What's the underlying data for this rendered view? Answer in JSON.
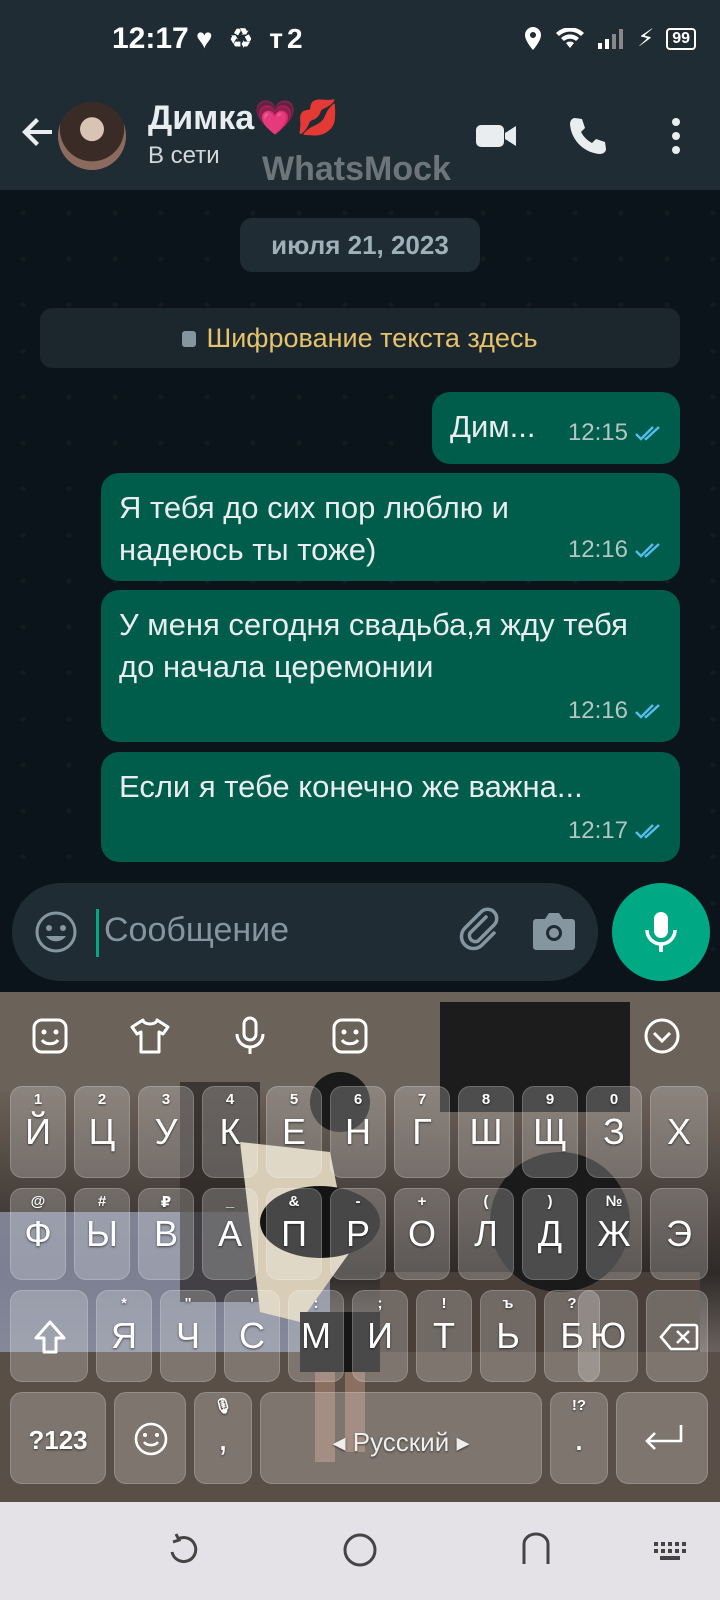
{
  "status_bar": {
    "time": "12:17",
    "left_icons": "♥ ♻ т2",
    "battery": "99"
  },
  "header": {
    "contact_name": "Димка💗💋",
    "status": "В сети",
    "watermark": "WhatsMock"
  },
  "chat": {
    "date_chip": "июля 21, 2023",
    "encryption_notice": "Шифрование текста здесь",
    "messages": [
      {
        "text": "Дим...",
        "time": "12:15"
      },
      {
        "text": "Я тебя до сих пор люблю и надеюсь ты тоже)",
        "time": "12:16"
      },
      {
        "text": "У меня сегодня свадьба,я жду тебя до начала церемонии",
        "time": "12:16"
      },
      {
        "text": "Если я тебе конечно же важна...",
        "time": "12:17"
      }
    ]
  },
  "composer": {
    "placeholder": "Сообщение"
  },
  "keyboard": {
    "row1": [
      {
        "key": "Й",
        "hint": "1"
      },
      {
        "key": "Ц",
        "hint": "2"
      },
      {
        "key": "У",
        "hint": "3"
      },
      {
        "key": "К",
        "hint": "4"
      },
      {
        "key": "Е",
        "hint": "5"
      },
      {
        "key": "Н",
        "hint": "6"
      },
      {
        "key": "Г",
        "hint": "7"
      },
      {
        "key": "Ш",
        "hint": "8"
      },
      {
        "key": "Щ",
        "hint": "9"
      },
      {
        "key": "З",
        "hint": "0"
      },
      {
        "key": "Х",
        "hint": ""
      }
    ],
    "row2": [
      {
        "key": "Ф",
        "hint": "@"
      },
      {
        "key": "Ы",
        "hint": "#"
      },
      {
        "key": "В",
        "hint": "₽"
      },
      {
        "key": "А",
        "hint": "_"
      },
      {
        "key": "П",
        "hint": "&"
      },
      {
        "key": "Р",
        "hint": "-"
      },
      {
        "key": "О",
        "hint": "+"
      },
      {
        "key": "Л",
        "hint": "("
      },
      {
        "key": "Д",
        "hint": ")"
      },
      {
        "key": "Ж",
        "hint": "№"
      },
      {
        "key": "Э",
        "hint": ""
      }
    ],
    "row3": [
      {
        "key": "Я",
        "hint": "*"
      },
      {
        "key": "Ч",
        "hint": "\""
      },
      {
        "key": "С",
        "hint": "'"
      },
      {
        "key": "М",
        "hint": ":"
      },
      {
        "key": "И",
        "hint": ";"
      },
      {
        "key": "Т",
        "hint": "!"
      },
      {
        "key": "Ь",
        "hint": "ъ"
      },
      {
        "key": "Б",
        "hint": "?"
      },
      {
        "key": "Ю",
        "hint": ""
      }
    ],
    "symbols_key": "?123",
    "comma_key": ",",
    "space_label": "◂ Русский ▸",
    "period_key": ".",
    "period_hint": "!?"
  }
}
